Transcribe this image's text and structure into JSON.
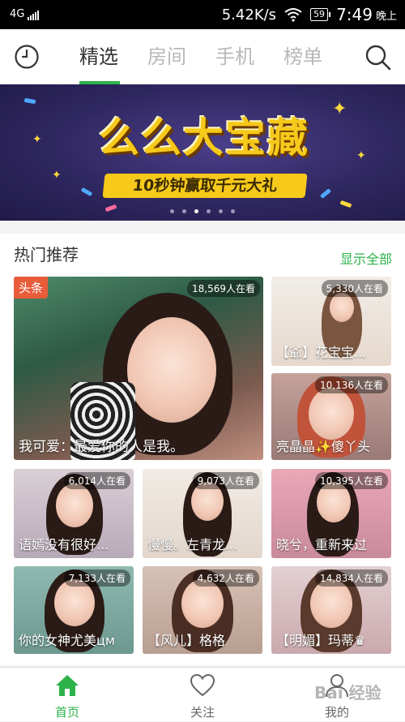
{
  "status_bar": {
    "network": "4G",
    "speed": "5.42K/s",
    "battery": "59",
    "time": "7:49",
    "ampm": "晚上"
  },
  "tabs": [
    {
      "label": "精选",
      "active": true
    },
    {
      "label": "房间",
      "active": false
    },
    {
      "label": "手机",
      "active": false
    },
    {
      "label": "榜单",
      "active": false
    }
  ],
  "banner": {
    "title": "么么大宝藏",
    "subtitle": "10秒钟赢取千元大礼",
    "slide_count": 6,
    "active_slide": 2
  },
  "section": {
    "title": "热门推荐",
    "show_all": "显示全部"
  },
  "cards": [
    {
      "tag": "头条",
      "viewers": "18,569人在看",
      "caption": "我可爱：最爱你的人是我。"
    },
    {
      "viewers": "5,330人在看",
      "caption": "【爺】花宝宝..."
    },
    {
      "viewers": "10,136人在看",
      "caption": "亮晶晶✨傻丫头"
    },
    {
      "viewers": "6,014人在看",
      "caption": "语嫣没有很好..."
    },
    {
      "viewers": "9,073人在看",
      "caption": "慢慢。左青龙..."
    },
    {
      "viewers": "10,395人在看",
      "caption": "晓兮，重新来过"
    },
    {
      "viewers": "7,133人在看",
      "caption": "你的女神尤美цм"
    },
    {
      "viewers": "4,632人在看",
      "caption": "【风儿】格格"
    },
    {
      "viewers": "14,834人在看",
      "caption": "【明媚】玛蒂♛"
    }
  ],
  "bottom_nav": [
    {
      "label": "首页",
      "icon": "home-icon",
      "active": true
    },
    {
      "label": "关注",
      "icon": "heart-icon",
      "active": false
    },
    {
      "label": "我的",
      "icon": "person-icon",
      "active": false
    }
  ],
  "watermark": "Bai 经验",
  "colors": {
    "accent": "#2db24a",
    "tag": "#e85c3a",
    "banner_yellow": "#f6c91b"
  }
}
